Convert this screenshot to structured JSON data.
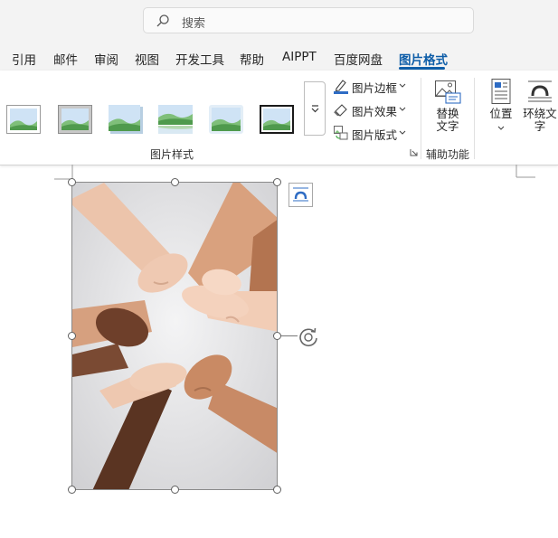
{
  "search": {
    "placeholder": "搜索"
  },
  "tabs": [
    {
      "label": "引用"
    },
    {
      "label": "邮件"
    },
    {
      "label": "审阅"
    },
    {
      "label": "视图"
    },
    {
      "label": "开发工具"
    },
    {
      "label": "帮助"
    },
    {
      "label": "AIPPT"
    },
    {
      "label": "百度网盘"
    },
    {
      "label": "图片格式",
      "active": true
    }
  ],
  "ribbon": {
    "picture_styles": {
      "group_label": "图片样式",
      "border_label": "图片边框",
      "effects_label": "图片效果",
      "layout_label": "图片版式"
    },
    "accessibility": {
      "group_label": "辅助功能",
      "alt_text_line1": "替换",
      "alt_text_line2": "文字"
    },
    "arrange": {
      "position_label": "位置",
      "wrap_line1": "环绕文",
      "wrap_line2": "字"
    }
  },
  "colors": {
    "accent": "#0f5ea8",
    "ribbon_bg": "#f3f3f3",
    "skin_light": "#f0c9b0",
    "skin_dark": "#5a3422"
  }
}
